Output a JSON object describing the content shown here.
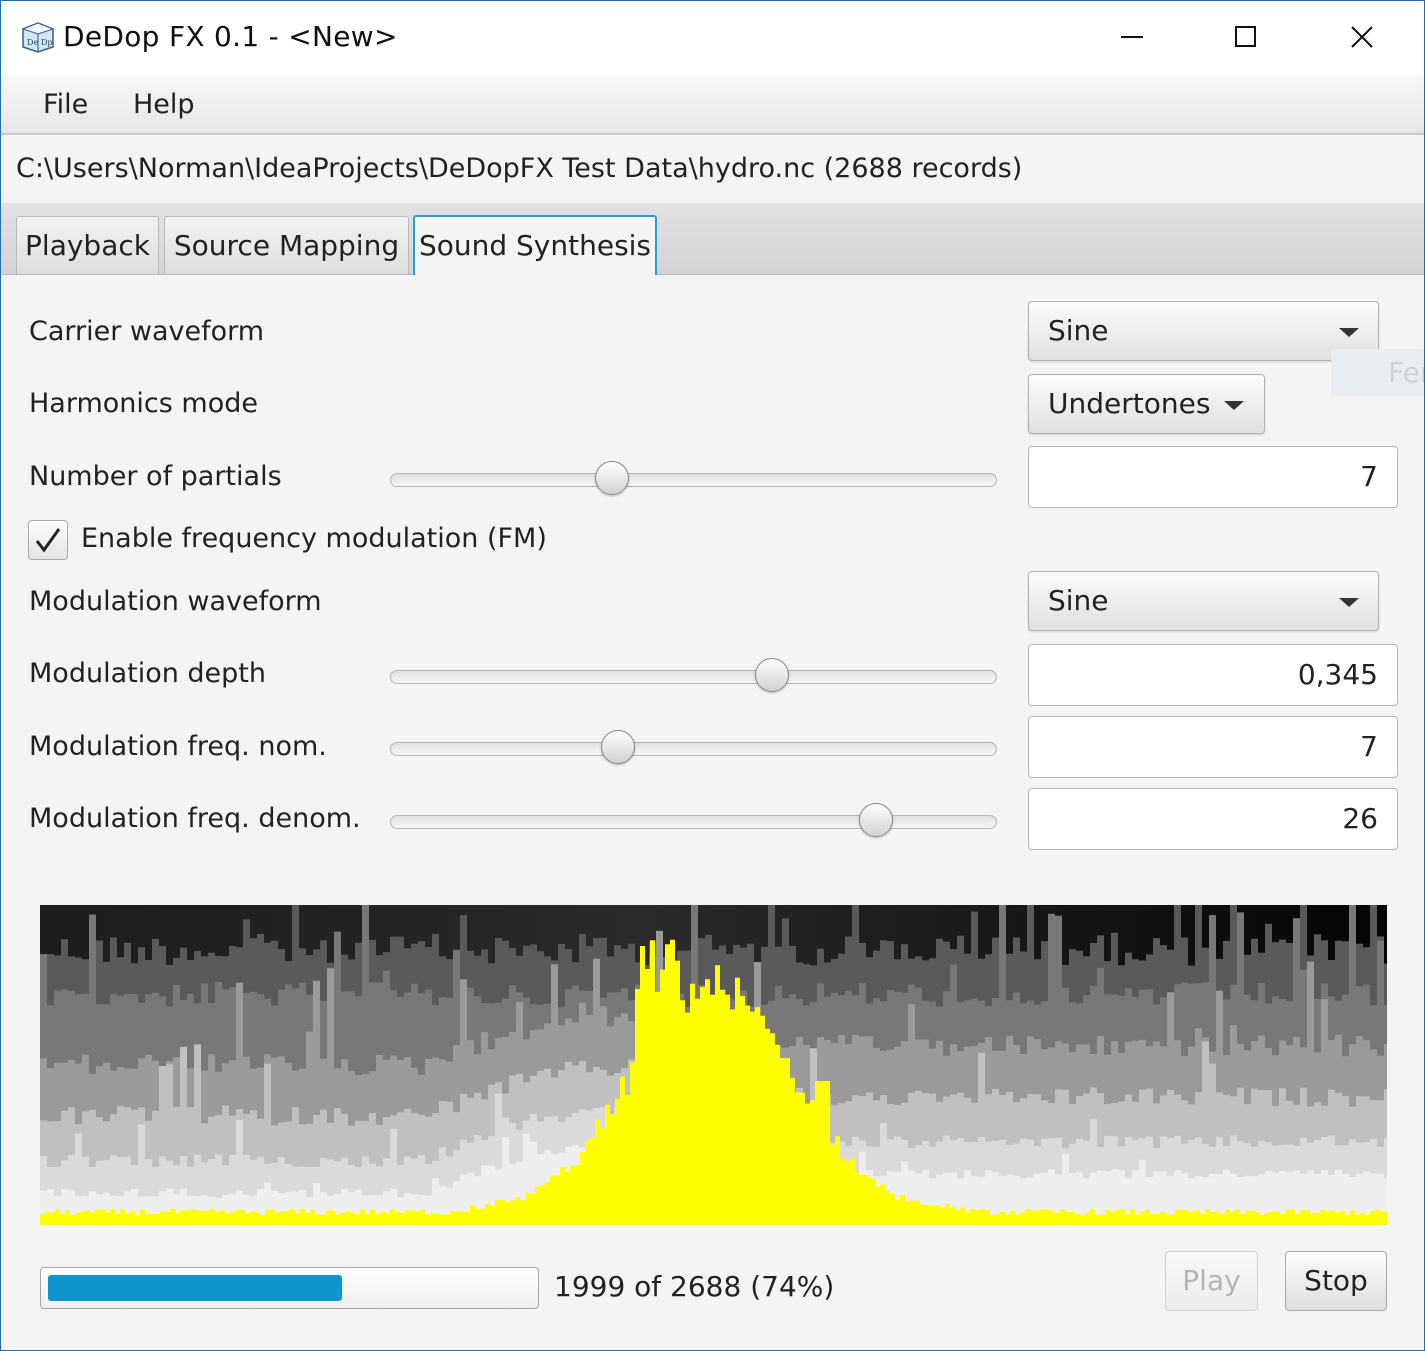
{
  "window": {
    "title": "DeDop FX 0.1 - <New>",
    "icon": "dedop-app-icon",
    "controls": [
      "minimize-icon",
      "maximize-icon",
      "close-icon"
    ]
  },
  "menu": {
    "file": "File",
    "help": "Help"
  },
  "source_info": "C:\\Users\\Norman\\IdeaProjects\\DeDopFX Test Data\\hydro.nc (2688 records)",
  "tabs": [
    {
      "label": "Playback",
      "selected": false
    },
    {
      "label": "Source Mapping",
      "selected": false
    },
    {
      "label": "Sound Synthesis",
      "selected": true
    }
  ],
  "form": {
    "carrier_waveform": {
      "label": "Carrier waveform",
      "value": "Sine"
    },
    "harmonics_mode": {
      "label": "Harmonics mode",
      "value": "Undertones"
    },
    "num_partials": {
      "label": "Number of partials",
      "value": "7",
      "slider_fraction": 0.365
    },
    "fm_enabled": {
      "label": "Enable frequency modulation (FM)",
      "checked": true
    },
    "mod_waveform": {
      "label": "Modulation waveform",
      "value": "Sine"
    },
    "mod_depth": {
      "label": "Modulation depth",
      "value": "0,345",
      "slider_fraction": 0.63
    },
    "mod_freq_nom": {
      "label": "Modulation freq. nom.",
      "value": "7",
      "slider_fraction": 0.375
    },
    "mod_freq_denom": {
      "label": "Modulation freq. denom.",
      "value": "26",
      "slider_fraction": 0.8
    }
  },
  "ghost_tooltip": "Fer",
  "progress": {
    "text": "1999 of 2688 (74%)",
    "fraction": 0.74
  },
  "buttons": {
    "play": "Play",
    "stop": "Stop"
  },
  "colors": {
    "accent": "#0e94cf",
    "tab_focus": "#2a9fd6",
    "spectrum_highlight": "#ffff00"
  }
}
